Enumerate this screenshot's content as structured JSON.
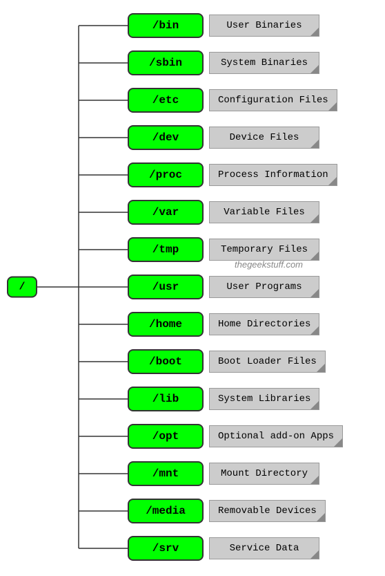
{
  "root": "/",
  "watermark": "thegeekstuff.com",
  "nodes": [
    {
      "path": "/bin",
      "label": "User Binaries"
    },
    {
      "path": "/sbin",
      "label": "System Binaries"
    },
    {
      "path": "/etc",
      "label": "Configuration Files"
    },
    {
      "path": "/dev",
      "label": "Device Files"
    },
    {
      "path": "/proc",
      "label": "Process Information"
    },
    {
      "path": "/var",
      "label": "Variable Files"
    },
    {
      "path": "/tmp",
      "label": "Temporary Files"
    },
    {
      "path": "/usr",
      "label": "User Programs"
    },
    {
      "path": "/home",
      "label": "Home Directories"
    },
    {
      "path": "/boot",
      "label": "Boot Loader Files"
    },
    {
      "path": "/lib",
      "label": "System Libraries"
    },
    {
      "path": "/opt",
      "label": "Optional add-on Apps"
    },
    {
      "path": "/mnt",
      "label": "Mount Directory"
    },
    {
      "path": "/media",
      "label": "Removable Devices"
    },
    {
      "path": "/srv",
      "label": "Service Data"
    }
  ]
}
